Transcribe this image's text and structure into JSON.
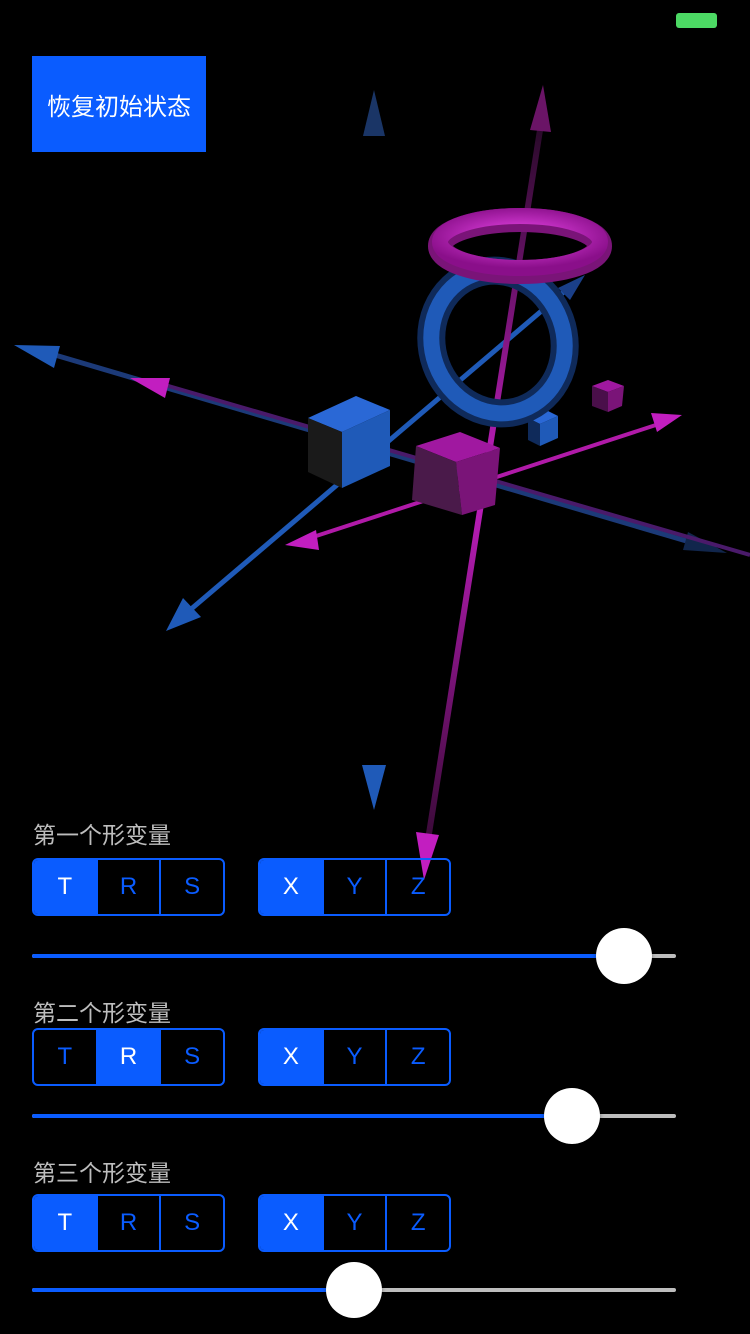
{
  "status_bar": {
    "battery_color": "#4cd964"
  },
  "reset_button": {
    "label": "恢复初始状态"
  },
  "colors": {
    "accent": "#0a5cff",
    "magenta": "#c21ec0",
    "blue_object": "#1a56c4"
  },
  "transforms": [
    {
      "title": "第一个形变量",
      "modes": [
        "T",
        "R",
        "S"
      ],
      "selected_mode": 0,
      "axes": [
        "X",
        "Y",
        "Z"
      ],
      "selected_axis": 0,
      "value": 0.96
    },
    {
      "title": "第二个形变量",
      "modes": [
        "T",
        "R",
        "S"
      ],
      "selected_mode": 1,
      "axes": [
        "X",
        "Y",
        "Z"
      ],
      "selected_axis": 0,
      "value": 0.87
    },
    {
      "title": "第三个形变量",
      "modes": [
        "T",
        "R",
        "S"
      ],
      "selected_mode": 0,
      "axes": [
        "X",
        "Y",
        "Z"
      ],
      "selected_axis": 0,
      "value": 0.5
    }
  ]
}
